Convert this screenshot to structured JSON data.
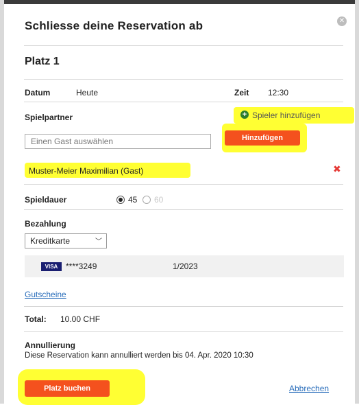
{
  "dialog": {
    "title": "Schliesse deine Reservation ab",
    "close_icon": "close-circle-icon",
    "court": "Platz 1"
  },
  "date": {
    "label": "Datum",
    "value": "Heute"
  },
  "time": {
    "label": "Zeit",
    "value": "12:30"
  },
  "partners": {
    "label": "Spielpartner",
    "add_player_label": "Spieler hinzufügen",
    "add_player_icon": "plus-circle-icon",
    "guest_input_placeholder": "Einen Gast auswählen",
    "add_button_label": "Hinzufügen",
    "selected_guest": "Muster-Meier Maximilian (Gast)",
    "remove_icon": "x-icon"
  },
  "duration": {
    "label": "Spieldauer",
    "options": [
      {
        "value": "45",
        "selected": true,
        "enabled": true
      },
      {
        "value": "60",
        "selected": false,
        "enabled": false
      }
    ]
  },
  "payment": {
    "label": "Bezahlung",
    "method": "Kreditkarte",
    "card": {
      "brand": "VISA",
      "number": "****3249",
      "expiry": "1/2023"
    },
    "vouchers_link": "Gutscheine"
  },
  "total": {
    "label": "Total:",
    "value": "10.00 CHF"
  },
  "cancellation": {
    "label": "Annullierung",
    "text": "Diese Reservation kann annulliert werden bis 04. Apr. 2020 10:30"
  },
  "actions": {
    "book_label": "Platz buchen",
    "cancel_label": "Abbrechen"
  },
  "colors": {
    "accent": "#f4511e",
    "link": "#2a6ebb",
    "highlight": "#ffff00",
    "remove": "#e53935"
  }
}
